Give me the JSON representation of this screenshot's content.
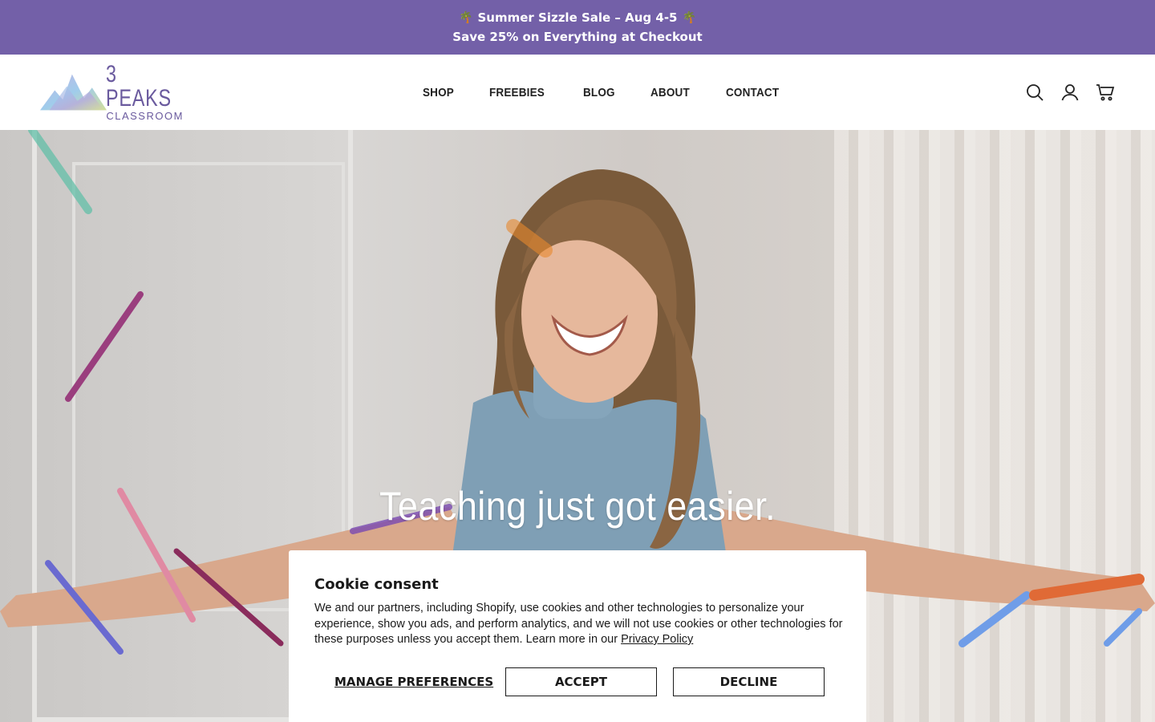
{
  "announcement": {
    "line1": "Summer Sizzle Sale – Aug 4-5",
    "line2": "Save 25% on Everything at Checkout",
    "icon": "palm-tree-icon",
    "background": "#7360a8"
  },
  "header": {
    "logo_main": "3 PEAKS",
    "logo_sub": "CLASSROOM",
    "nav": [
      "SHOP",
      "FREEBIES",
      "BLOG",
      "ABOUT",
      "CONTACT"
    ],
    "icons": [
      "search-icon",
      "account-icon",
      "cart-icon"
    ]
  },
  "hero": {
    "headline": "Teaching just got easier."
  },
  "cookie": {
    "title": "Cookie consent",
    "body": "We and our partners, including Shopify, use cookies and other technologies to personalize your experience, show you ads, and perform analytics, and we will not use cookies or other technologies for these purposes unless you accept them. Learn more in our ",
    "privacy_link": "Privacy Policy",
    "manage_label": "MANAGE PREFERENCES",
    "accept_label": "ACCEPT",
    "decline_label": "DECLINE"
  }
}
